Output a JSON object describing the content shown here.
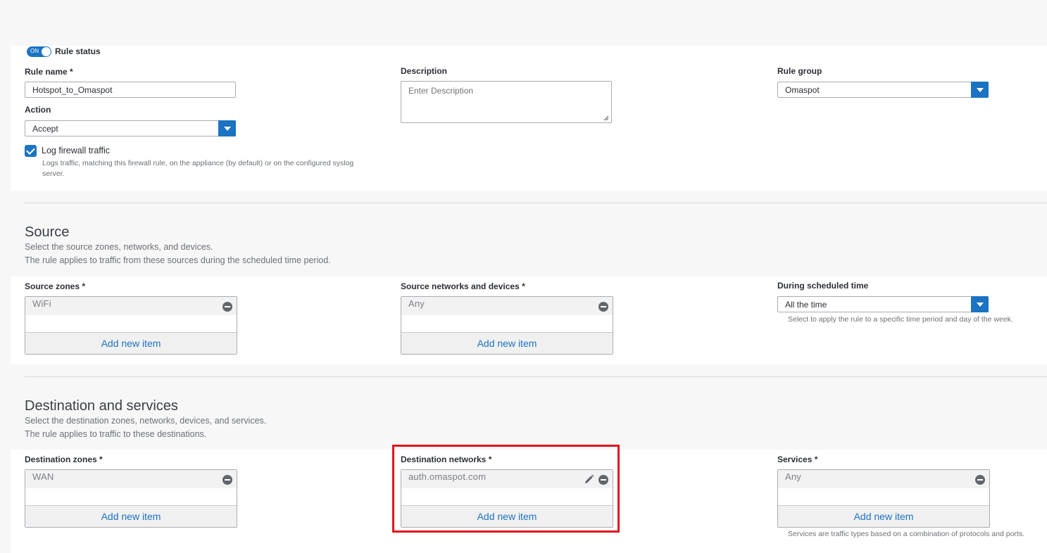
{
  "general": {
    "rule_status": {
      "label": "Rule status",
      "toggle_text": "ON",
      "enabled": true
    },
    "rule_name": {
      "label": "Rule name *",
      "value": "Hotspot_to_Omaspot"
    },
    "description": {
      "label": "Description",
      "placeholder": "Enter Description"
    },
    "rule_group": {
      "label": "Rule group",
      "value": "Omaspot"
    },
    "action": {
      "label": "Action",
      "value": "Accept"
    },
    "log_traffic": {
      "label": "Log firewall traffic",
      "checked": true,
      "hint_line1": "Logs traffic, matching this firewall rule, on the appliance (by default) or on the configured syslog",
      "hint_line2": "server."
    }
  },
  "source": {
    "title": "Source",
    "subtitle1": "Select the source zones, networks, and devices.",
    "subtitle2": "The rule applies to traffic from these sources during the scheduled time period.",
    "zones": {
      "label": "Source zones *",
      "item": "WiFi",
      "add": "Add new item"
    },
    "networks": {
      "label": "Source networks and devices *",
      "item": "Any",
      "add": "Add new item"
    },
    "schedule": {
      "label": "During scheduled time",
      "value": "All the time",
      "hint": "Select to apply the rule to a specific time period and day of the week."
    }
  },
  "destination": {
    "title": "Destination and services",
    "subtitle1": "Select the destination zones, networks, devices, and services.",
    "subtitle2": "The rule applies to traffic to these destinations.",
    "zones": {
      "label": "Destination zones *",
      "item": "WAN",
      "add": "Add new item"
    },
    "networks": {
      "label": "Destination networks *",
      "item": "auth.omaspot.com",
      "add": "Add new item"
    },
    "services": {
      "label": "Services *",
      "item": "Any",
      "add": "Add new item",
      "hint": "Services are traffic types based on a combination of protocols and ports."
    }
  },
  "colors": {
    "accent": "#1b73c2",
    "highlight": "#e0141e"
  }
}
